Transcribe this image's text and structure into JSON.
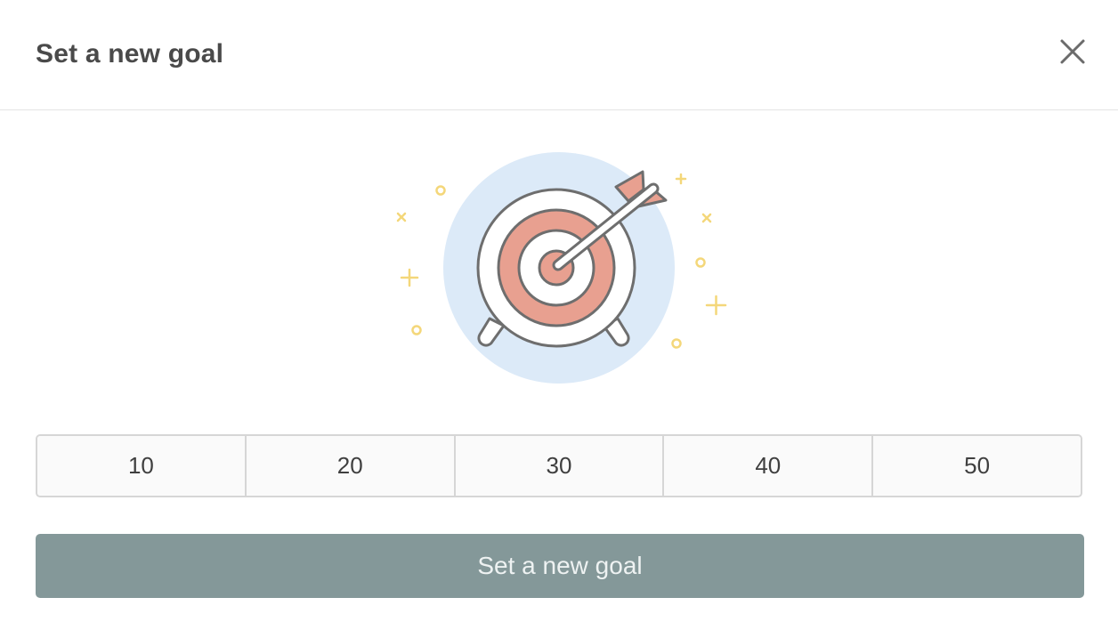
{
  "dialog": {
    "title": "Set a new goal",
    "close_icon": "close-icon"
  },
  "illustration": {
    "icon": "target-with-arrow-icon",
    "colors": {
      "circle_bg": "#dceaf8",
      "ring_fill": "#e8a090",
      "outline": "#6e6e6e",
      "sparkle": "#f4d77a"
    }
  },
  "goal_options": [
    "10",
    "20",
    "30",
    "40",
    "50"
  ],
  "submit_button": {
    "label": "Set a new goal",
    "color": "#849899"
  }
}
